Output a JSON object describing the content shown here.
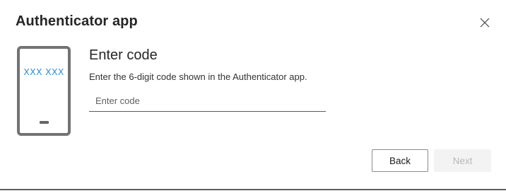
{
  "dialog": {
    "title": "Authenticator app",
    "close_icon": "close-icon"
  },
  "illustration": {
    "icon": "phone-icon",
    "code_text": "XXX XXX",
    "code_color": "#2e8fd6"
  },
  "content": {
    "heading": "Enter code",
    "instructions": "Enter the 6-digit code shown in the Authenticator app.",
    "code_input": {
      "value": "",
      "placeholder": "Enter code"
    }
  },
  "actions": {
    "back_label": "Back",
    "next_label": "Next",
    "next_disabled": true
  }
}
